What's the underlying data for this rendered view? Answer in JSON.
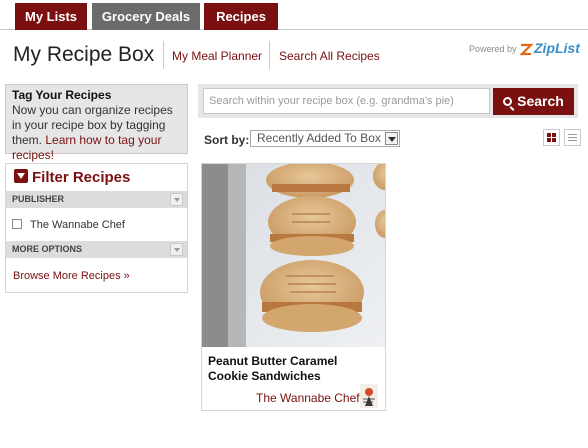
{
  "tabs": [
    {
      "label": "My Lists",
      "active": false
    },
    {
      "label": "Grocery Deals",
      "active": false
    },
    {
      "label": "Recipes",
      "active": true
    }
  ],
  "header": {
    "title": "My Recipe Box",
    "links": [
      "My Meal Planner",
      "Search All Recipes"
    ],
    "powered_by": "Powered by",
    "brand": "ZipList"
  },
  "tag_box": {
    "heading": "Tag Your Recipes",
    "body": "Now you can organize recipes in your recipe box by tagging them.",
    "link": "Learn how to tag your recipes!"
  },
  "filter": {
    "heading": "Filter Recipes",
    "sections": [
      {
        "label": "PUBLISHER",
        "options": [
          {
            "label": "The Wannabe Chef",
            "checked": false
          }
        ]
      },
      {
        "label": "MORE OPTIONS"
      }
    ],
    "browse_link": "Browse More Recipes »"
  },
  "search": {
    "placeholder": "Search within your recipe box (e.g. grandma's pie)",
    "value": "",
    "button_label": "Search"
  },
  "sort": {
    "label": "Sort by:",
    "selected": "Recently Added To Box"
  },
  "view_modes": [
    {
      "name": "grid",
      "active": true
    },
    {
      "name": "list",
      "active": false
    }
  ],
  "recipes": [
    {
      "name": "Peanut Butter Caramel Cookie Sandwiches",
      "publisher": "The Wannabe Chef"
    }
  ],
  "colors": {
    "brand": "#7a1010",
    "tab_inactive": "#6b6b6b",
    "panel": "#e6e6e6"
  }
}
